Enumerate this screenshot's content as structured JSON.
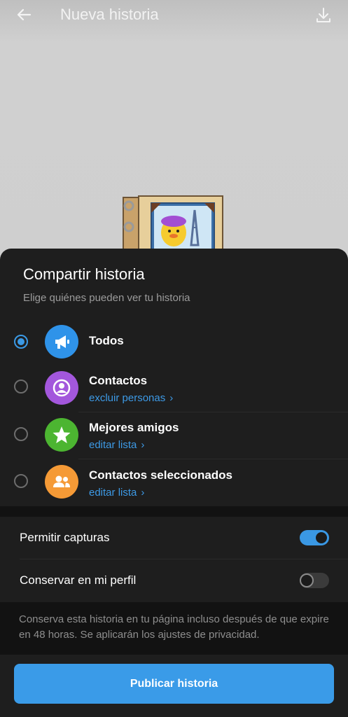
{
  "header": {
    "title": "Nueva historia",
    "back_icon": "arrow-left-icon",
    "download_icon": "download-icon"
  },
  "sheet": {
    "title": "Compartir historia",
    "subtitle": "Elige quiénes pueden ver tu historia",
    "options": [
      {
        "label": "Todos",
        "sublabel": "",
        "icon": "megaphone-icon",
        "color": "#2f93e9",
        "selected": true
      },
      {
        "label": "Contactos",
        "sublabel": "excluir personas",
        "icon": "person-icon",
        "color": "#a357dc",
        "selected": false
      },
      {
        "label": "Mejores amigos",
        "sublabel": "editar lista",
        "icon": "star-icon",
        "color": "#4cb531",
        "selected": false
      },
      {
        "label": "Contactos seleccionados",
        "sublabel": "editar lista",
        "icon": "group-icon",
        "color": "#f59a36",
        "selected": false
      }
    ],
    "settings": [
      {
        "label": "Permitir capturas",
        "enabled": true
      },
      {
        "label": "Conservar en mi perfil",
        "enabled": false
      }
    ],
    "info": "Conserva esta historia en tu página incluso después de que expire en 48 horas. Se aplicarán los ajustes de privacidad.",
    "publish_label": "Publicar historia",
    "chevron": "›"
  },
  "colors": {
    "accent": "#3a9be8",
    "sheet_bg": "#1e1e1e"
  }
}
